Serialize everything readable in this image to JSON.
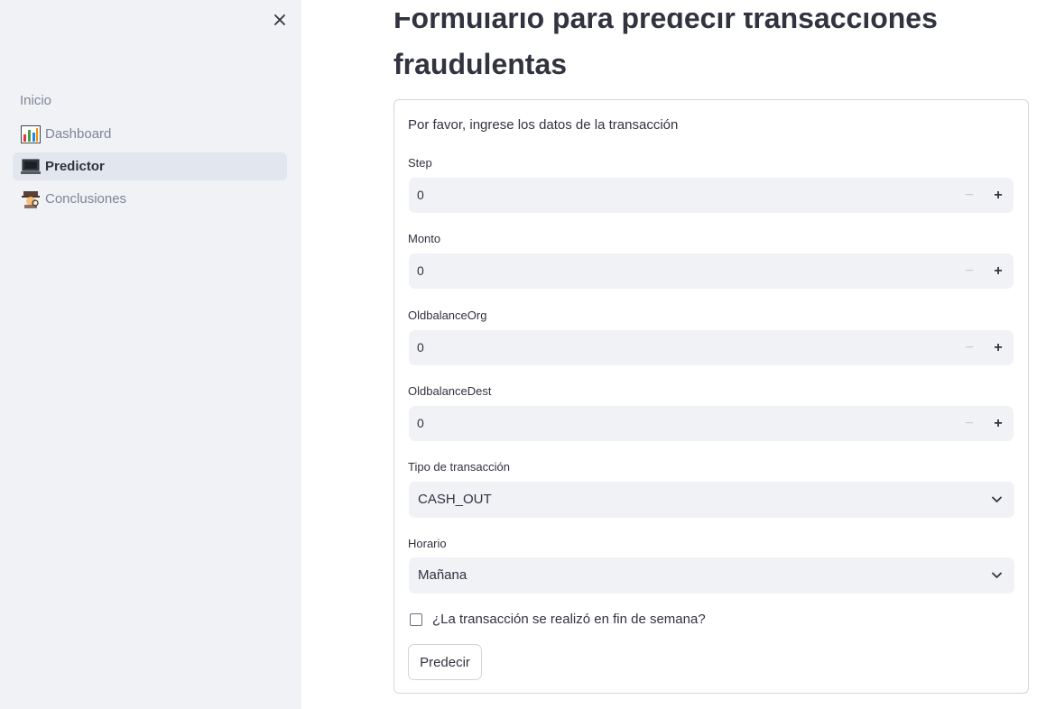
{
  "sidebar": {
    "close_icon": "close-icon",
    "heading": "Inicio",
    "items": [
      {
        "label": "Dashboard",
        "icon": "bar-chart-icon",
        "active": false
      },
      {
        "label": "Predictor",
        "icon": "laptop-icon",
        "active": true
      },
      {
        "label": "Conclusiones",
        "icon": "detective-icon",
        "active": false
      }
    ]
  },
  "main": {
    "title_line1": "Formulario para predecir transacciones",
    "title_line2": "fraudulentas",
    "form": {
      "intro": "Por favor, ingrese los datos de la transacción",
      "fields": [
        {
          "label": "Step",
          "value": "0"
        },
        {
          "label": "Monto",
          "value": "0"
        },
        {
          "label": "OldbalanceOrg",
          "value": "0"
        },
        {
          "label": "OldbalanceDest",
          "value": "0"
        }
      ],
      "minus_glyph": "−",
      "plus_glyph": "+",
      "selects": [
        {
          "label": "Tipo de transacción",
          "value": "CASH_OUT"
        },
        {
          "label": "Horario",
          "value": "Mañana"
        }
      ],
      "checkbox_label": "¿La transacción se realizó en fin de semana?",
      "checkbox_checked": false,
      "submit_label": "Predecir"
    }
  },
  "colors": {
    "sidebar_bg": "#f0f2f6",
    "active_item_bg": "#e2e6ee",
    "text": "#31333f",
    "muted": "#808495"
  }
}
